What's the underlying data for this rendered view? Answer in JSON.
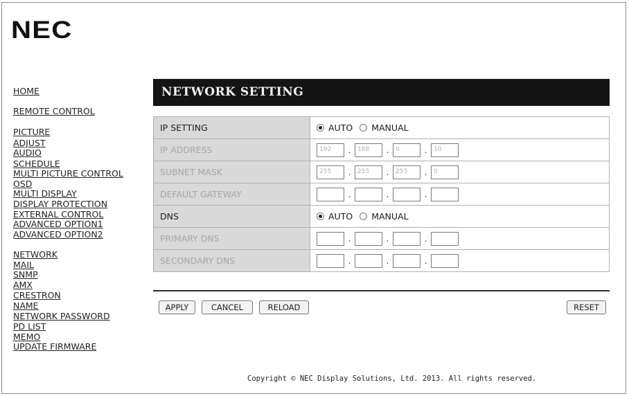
{
  "brand": {
    "logo": "NEC"
  },
  "sidebar": {
    "items": [
      {
        "label": "HOME"
      },
      {
        "label": "REMOTE CONTROL"
      },
      {
        "label": "PICTURE"
      },
      {
        "label": "ADJUST"
      },
      {
        "label": "AUDIO"
      },
      {
        "label": "SCHEDULE"
      },
      {
        "label": "MULTI PICTURE CONTROL"
      },
      {
        "label": "OSD"
      },
      {
        "label": "MULTI DISPLAY"
      },
      {
        "label": "DISPLAY PROTECTION"
      },
      {
        "label": "EXTERNAL CONTROL"
      },
      {
        "label": "ADVANCED OPTION1"
      },
      {
        "label": "ADVANCED OPTION2"
      },
      {
        "label": "NETWORK"
      },
      {
        "label": "MAIL"
      },
      {
        "label": "SNMP"
      },
      {
        "label": "AMX"
      },
      {
        "label": "CRESTRON"
      },
      {
        "label": "NAME"
      },
      {
        "label": "NETWORK PASSWORD"
      },
      {
        "label": "PD LIST"
      },
      {
        "label": "MEMO"
      },
      {
        "label": "UPDATE FIRMWARE"
      }
    ]
  },
  "page_title": "NETWORK SETTING",
  "settings": {
    "ip_setting": {
      "label": "IP SETTING",
      "options": [
        "AUTO",
        "MANUAL"
      ],
      "selected": "AUTO"
    },
    "ip_address": {
      "label": "IP ADDRESS",
      "octets": [
        "192",
        "168",
        "0",
        "10"
      ]
    },
    "subnet_mask": {
      "label": "SUBNET MASK",
      "octets": [
        "255",
        "255",
        "255",
        "0"
      ]
    },
    "default_gateway": {
      "label": "DEFAULT GATEWAY",
      "octets": [
        "",
        "",
        "",
        ""
      ]
    },
    "dns": {
      "label": "DNS",
      "options": [
        "AUTO",
        "MANUAL"
      ],
      "selected": "AUTO"
    },
    "primary_dns": {
      "label": "PRIMARY DNS",
      "octets": [
        "",
        "",
        "",
        ""
      ]
    },
    "secondary_dns": {
      "label": "SECONDARY DNS",
      "octets": [
        "",
        "",
        "",
        ""
      ]
    },
    "separator": "."
  },
  "buttons": {
    "apply": "APPLY",
    "cancel": "CANCEL",
    "reload": "RELOAD",
    "reset": "RESET"
  },
  "footer": {
    "copyright": "Copyright © NEC Display Solutions, Ltd. 2013. All rights reserved."
  }
}
